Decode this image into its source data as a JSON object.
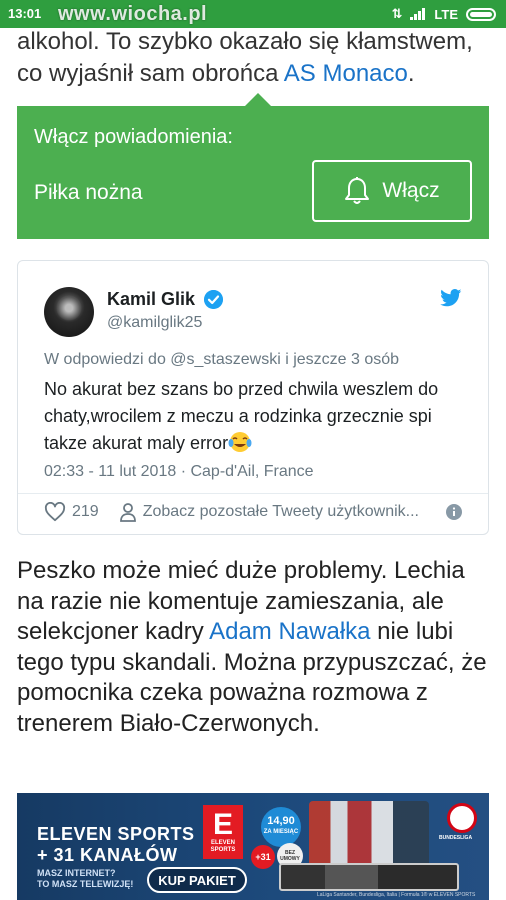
{
  "status_bar": {
    "time": "13:01",
    "watermark": "www.wiocha.pl",
    "network": "LTE"
  },
  "article_top": {
    "line1": "alkohol. To szybko okazało się kłamstwem,",
    "line2_pre": "co wyjaśnił sam obrońca ",
    "line2_link": "AS Monaco",
    "line2_post": "."
  },
  "notification": {
    "title": "Włącz powiadomienia:",
    "topic": "Piłka nożna",
    "button": "Włącz",
    "bell_icon": "bell-icon",
    "bg_color": "#4caf50"
  },
  "tweet": {
    "name": "Kamil Glik",
    "handle": "@kamilglik25",
    "reply_to": "W odpowiedzi do @s_staszewski i jeszcze 3 osób",
    "text": "No akurat bez szans bo przed chwila weszlem do chaty,wrocilem z meczu a rodzinka grzecznie spi takze akurat maly error",
    "emoji": "😂",
    "meta": "02:33 - 11 lut 2018 · Cap-d'Ail, France",
    "likes": "219",
    "more_tweets": "Zobacz pozostałe Tweety użytkownik...",
    "accent_color": "#1da1f2"
  },
  "article_bottom": {
    "part1": "Peszko może mieć duże problemy. Lechia na razie nie komentuje zamieszania, ale selekcjoner kadry ",
    "link": "Adam Nawałka",
    "part2": " nie lubi tego typu skandali. Można przypuszczać, że pomocnika czeka poważna rozmowa z trenerem Biało-Czerwonych."
  },
  "ad": {
    "headline1": "ELEVEN SPORTS",
    "headline2": "+ 31 KANAŁÓW",
    "subline1": "MASZ INTERNET?",
    "subline2": "TO MASZ TELEWIZJĘ!",
    "cta": "KUP PAKIET",
    "logo_letter": "E",
    "logo_text1": "ELEVEN",
    "logo_text2": "SPORTS",
    "price": "14,90",
    "price_unit": "ZA MIESIĄC",
    "plus": "+31",
    "bez_umowy": "BEZ UMOWY",
    "bundesliga": "BUNDESLIGA",
    "footer": "LaLiga Santander, Bundesliga, Italia | Formuła 1® w ELEVEN SPORTS"
  }
}
